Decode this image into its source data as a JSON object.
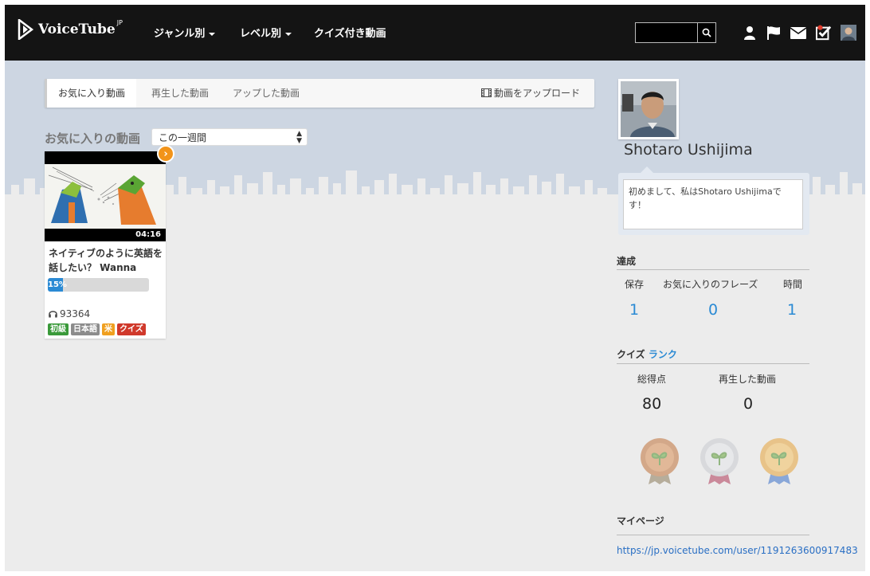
{
  "nav": {
    "logo_text": "VoiceTube",
    "logo_sup": "JP",
    "items": [
      {
        "label": "ジャンル別"
      },
      {
        "label": "レベル別"
      },
      {
        "label": "クイズ付き動画"
      }
    ],
    "search_placeholder": ""
  },
  "tabs": {
    "items": [
      {
        "label": "お気に入り動画"
      },
      {
        "label": "再生した動画"
      },
      {
        "label": "アップした動画"
      }
    ],
    "upload_label": "動画をアップロード"
  },
  "favorites": {
    "title": "お気に入りの動画",
    "period": "この一週間"
  },
  "video": {
    "duration": "04:16",
    "title": "ネイティブのように英語を話したい？ Wanna",
    "progress_label": "15%",
    "progress_value": 0.15,
    "views": "93364",
    "tags": [
      {
        "label": "初級",
        "color": "#3a9a3a"
      },
      {
        "label": "日本語",
        "color": "#8c8c8c"
      },
      {
        "label": "米",
        "color": "#f0a020"
      },
      {
        "label": "クイズ",
        "color": "#d0392b"
      }
    ]
  },
  "profile": {
    "name": "Shotaro Ushijima",
    "bio": "初めまして、私はShotaro Ushijimaです！"
  },
  "achievements": {
    "heading": "達成",
    "stats": [
      {
        "label": "保存",
        "value": "1"
      },
      {
        "label": "お気に入りのフレーズ",
        "value": "0"
      },
      {
        "label": "時間",
        "value": "1"
      }
    ]
  },
  "quiz": {
    "heading": "クイズ",
    "rank_link": "ランク",
    "stats": [
      {
        "label": "総得点",
        "value": "80"
      },
      {
        "label": "再生した動画",
        "value": "0"
      }
    ]
  },
  "mypage": {
    "heading": "マイページ",
    "url": "https://jp.voicetube.com/user/1191263600917483"
  },
  "colors": {
    "accent": "#2a8ad4",
    "nav_bg": "#141414",
    "sky": "#cdd6e2"
  }
}
